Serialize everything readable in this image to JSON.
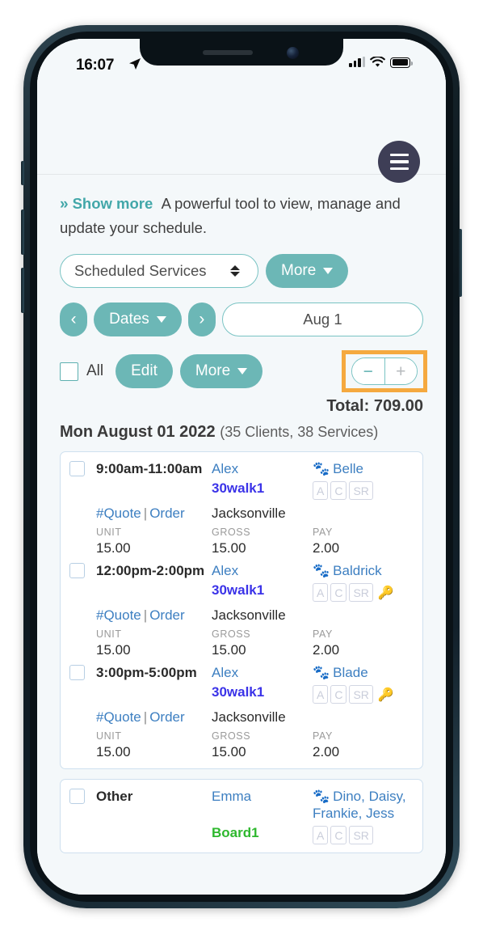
{
  "status_bar": {
    "time": "16:07",
    "location_icon": "location-arrow-icon",
    "signal_icon": "cellular-signal-icon",
    "wifi_icon": "wifi-icon",
    "battery_icon": "battery-full-icon"
  },
  "header": {
    "menu_icon": "hamburger-menu-icon"
  },
  "intro": {
    "chevrons": "»",
    "show_more_label": "Show more",
    "description": "A powerful tool to view, manage and update your schedule."
  },
  "filters": {
    "view_select_value": "Scheduled Services",
    "more_button_label": "More"
  },
  "date_nav": {
    "prev_label": "‹",
    "dates_button_label": "Dates",
    "next_label": "›",
    "date_value": "Aug 1",
    "date_placeholder": "Aug 1"
  },
  "actions": {
    "all_checkbox_label": "All",
    "edit_button_label": "Edit",
    "more_button_label": "More",
    "zoom_out_label": "−",
    "zoom_in_label": "+",
    "highlight_color": "#f5a93f"
  },
  "summary": {
    "total_label": "Total: 709.00",
    "day_title": "Mon August 01 2022",
    "day_counts": "(35 Clients, 38 Services)"
  },
  "columns": {
    "unit": "UNIT",
    "gross": "GROSS",
    "pay": "PAY"
  },
  "links": {
    "quote": "#Quote",
    "separator": "|",
    "order": "Order"
  },
  "badge_labels": {
    "a": "A",
    "c": "C",
    "sr": "SR"
  },
  "icons": {
    "paw": "🐾",
    "key": "🔑"
  },
  "cards": [
    {
      "services": [
        {
          "time": "9:00am-11:00am",
          "staff": "Alex",
          "service_code": "30walk1",
          "service_code_color": "#3b33e8",
          "pets": "Belle",
          "city": "Jacksonville",
          "unit": "15.00",
          "gross": "15.00",
          "pay": "2.00",
          "has_key": false
        },
        {
          "time": "12:00pm-2:00pm",
          "staff": "Alex",
          "service_code": "30walk1",
          "service_code_color": "#3b33e8",
          "pets": "Baldrick",
          "city": "Jacksonville",
          "unit": "15.00",
          "gross": "15.00",
          "pay": "2.00",
          "has_key": true
        },
        {
          "time": "3:00pm-5:00pm",
          "staff": "Alex",
          "service_code": "30walk1",
          "service_code_color": "#3b33e8",
          "pets": "Blade",
          "city": "Jacksonville",
          "unit": "15.00",
          "gross": "15.00",
          "pay": "2.00",
          "has_key": true
        }
      ]
    },
    {
      "services": [
        {
          "time": "Other",
          "staff": "Emma",
          "service_code": "Board1",
          "service_code_color": "#2eb82e",
          "pets": "Dino, Daisy, Frankie, Jess",
          "city": "",
          "unit": "",
          "gross": "",
          "pay": "",
          "has_key": false
        }
      ]
    }
  ]
}
